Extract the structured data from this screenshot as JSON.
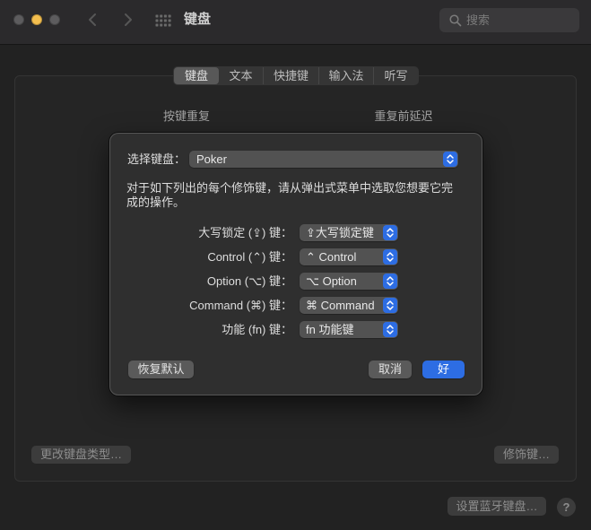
{
  "window": {
    "title": "键盘",
    "traffic_lights": {
      "close": "#5d5c5e",
      "minimize": "#f4bf4f",
      "zoom": "#5d5c5e"
    }
  },
  "toolbar": {
    "back_icon": "chevron-left-icon",
    "forward_icon": "chevron-right-icon",
    "show_all_icon": "grid-icon",
    "search_icon": "magnifier-icon",
    "search_placeholder": "搜索"
  },
  "tabs": [
    {
      "label": "键盘",
      "selected": true
    },
    {
      "label": "文本",
      "selected": false
    },
    {
      "label": "快捷键",
      "selected": false
    },
    {
      "label": "输入法",
      "selected": false
    },
    {
      "label": "听写",
      "selected": false
    }
  ],
  "keyboard_pane": {
    "key_repeat_label": "按键重复",
    "delay_until_repeat_label": "重复前延迟",
    "change_keyboard_type_button": "更改键盘类型…",
    "modifier_keys_button": "修饰键…"
  },
  "footer": {
    "bluetooth_keyboard_button": "设置蓝牙键盘…",
    "help_label": "?"
  },
  "modifier_sheet": {
    "select_keyboard_label": "选择键盘：",
    "selected_keyboard": "Poker",
    "description": "对于如下列出的每个修饰键，请从弹出式菜单中选取您想要它完成的操作。",
    "popup_icon": "up-down-chevron-icon",
    "modifiers": [
      {
        "label": "大写锁定 (⇪) 键：",
        "value": "⇪大写锁定键"
      },
      {
        "label": "Control (⌃) 键：",
        "value": "⌃ Control"
      },
      {
        "label": "Option (⌥) 键：",
        "value": "⌥ Option"
      },
      {
        "label": "Command (⌘) 键：",
        "value": "⌘ Command"
      },
      {
        "label": "功能 (fn) 键：",
        "value": "fn 功能键"
      }
    ],
    "restore_defaults_button": "恢复默认",
    "cancel_button": "取消",
    "ok_button": "好"
  },
  "colors": {
    "accent": "#2d6de3",
    "window_background": "#222222",
    "sheet_background": "#2f2f2f"
  }
}
